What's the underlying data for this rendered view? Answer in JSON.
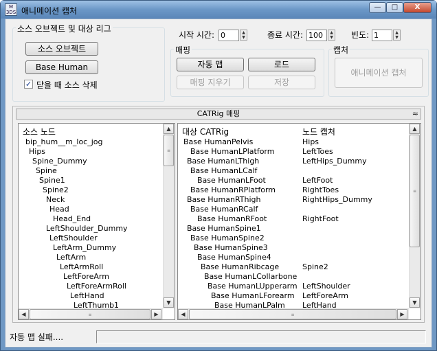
{
  "window": {
    "title": "애니메이션 캡처",
    "icon_text_top": "M",
    "icon_text_bottom": "3DS",
    "minimize": "—",
    "maximize": "□",
    "close": "X"
  },
  "source_group": {
    "label": "소스 오브젝트 및 대상 리그",
    "source_button": "소스 오브젝트",
    "base_button": "Base Human",
    "checkbox_label": "닫을 때 소스 삭제",
    "checkbox_mark": "✓"
  },
  "time": {
    "start_label": "시작 시간:",
    "start_value": "0",
    "end_label": "종료 시간:",
    "end_value": "100",
    "freq_label": "빈도:",
    "freq_value": "1"
  },
  "mapping_group": {
    "label": "매핑",
    "auto_map": "자동 맵",
    "load": "로드",
    "clear_map": "매핑 지우기",
    "save": "저장"
  },
  "capture_group": {
    "label": "캡처",
    "capture_button": "애니메이션 캡처"
  },
  "catrig_rollout": {
    "title": "CATRig 매핑",
    "collapse": "≈"
  },
  "source_list": {
    "header": "소스 노드",
    "items": [
      {
        "name": "bip_hum__m_loc_jog",
        "indent": 0
      },
      {
        "name": "Hips",
        "indent": 1
      },
      {
        "name": "Spine_Dummy",
        "indent": 2
      },
      {
        "name": "Spine",
        "indent": 3
      },
      {
        "name": "Spine1",
        "indent": 4
      },
      {
        "name": "Spine2",
        "indent": 5
      },
      {
        "name": "Neck",
        "indent": 6
      },
      {
        "name": "Head",
        "indent": 7
      },
      {
        "name": "Head_End",
        "indent": 8
      },
      {
        "name": "LeftShoulder_Dummy",
        "indent": 6
      },
      {
        "name": "LeftShoulder",
        "indent": 7
      },
      {
        "name": "LeftArm_Dummy",
        "indent": 8
      },
      {
        "name": "LeftArm",
        "indent": 9
      },
      {
        "name": "LeftArmRoll",
        "indent": 10
      },
      {
        "name": "LeftForeArm",
        "indent": 11
      },
      {
        "name": "LeftForeArmRoll",
        "indent": 12
      },
      {
        "name": "LeftHand",
        "indent": 13
      },
      {
        "name": "LeftThumb1",
        "indent": 14
      }
    ]
  },
  "target_list": {
    "header_target": "대상 CATRig",
    "header_capture": "노드 캡처",
    "rows": [
      {
        "target": "Base HumanPelvis",
        "capture": "Hips",
        "indent": 0
      },
      {
        "target": "Base HumanLPlatform",
        "capture": "LeftToes",
        "indent": 2
      },
      {
        "target": "Base HumanLThigh",
        "capture": "LeftHips_Dummy",
        "indent": 1
      },
      {
        "target": "Base HumanLCalf",
        "capture": "",
        "indent": 2
      },
      {
        "target": "Base HumanLFoot",
        "capture": "LeftFoot",
        "indent": 4
      },
      {
        "target": "Base HumanRPlatform",
        "capture": "RightToes",
        "indent": 2
      },
      {
        "target": "Base HumanRThigh",
        "capture": "RightHips_Dummy",
        "indent": 1
      },
      {
        "target": "Base HumanRCalf",
        "capture": "",
        "indent": 2
      },
      {
        "target": "Base HumanRFoot",
        "capture": "RightFoot",
        "indent": 4
      },
      {
        "target": "Base HumanSpine1",
        "capture": "",
        "indent": 1
      },
      {
        "target": "Base HumanSpine2",
        "capture": "",
        "indent": 2
      },
      {
        "target": "Base HumanSpine3",
        "capture": "",
        "indent": 3
      },
      {
        "target": "Base HumanSpine4",
        "capture": "",
        "indent": 4
      },
      {
        "target": "Base HumanRibcage",
        "capture": "Spine2",
        "indent": 5
      },
      {
        "target": "Base HumanLCollarbone",
        "capture": "",
        "indent": 6
      },
      {
        "target": "Base HumanLUpperarm",
        "capture": "LeftShoulder",
        "indent": 7
      },
      {
        "target": "Base HumanLForearm",
        "capture": "LeftForeArm",
        "indent": 8
      },
      {
        "target": "Base HumanLPalm",
        "capture": "LeftHand",
        "indent": 9
      }
    ]
  },
  "scroll": {
    "up": "▲",
    "down": "▼",
    "left": "◀",
    "right": "▶",
    "grip": "≡"
  },
  "status": {
    "text": "자동 맵 실패...."
  }
}
